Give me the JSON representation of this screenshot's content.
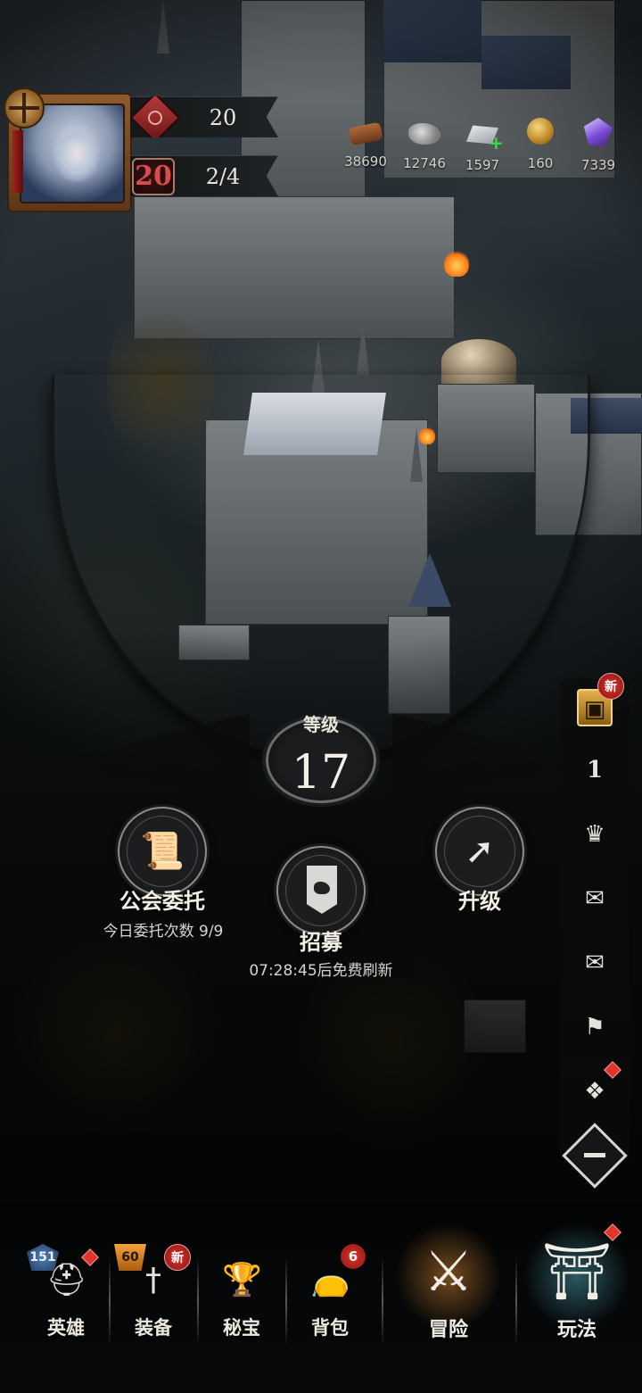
{
  "hud": {
    "player": {
      "portrait_icon": "hero-portrait-icon",
      "power_value": "20",
      "level_badge": "20",
      "slots_progress": "2/4"
    },
    "resources": [
      {
        "name": "wood",
        "icon": "wood-log-icon",
        "value": "38690"
      },
      {
        "name": "stone",
        "icon": "stone-icon",
        "value": "12746"
      },
      {
        "name": "iron",
        "icon": "iron-ingot-icon",
        "value": "1597",
        "has_plus": true
      },
      {
        "name": "gold",
        "icon": "gold-coin-icon",
        "value": "160"
      },
      {
        "name": "crystal",
        "icon": "purple-crystal-icon",
        "value": "7339"
      }
    ],
    "plus_mark": "+"
  },
  "level": {
    "label": "等级",
    "value": "17"
  },
  "actions": {
    "guild": {
      "title": "公会委托",
      "subtitle": "今日委托次数 9/9",
      "icon": "scroll-icon"
    },
    "recruit": {
      "title": "招募",
      "subtitle": "07:28:45后免费刷新",
      "icon": "banner-icon"
    },
    "upgrade": {
      "title": "升级",
      "icon": "arrow-up-icon"
    }
  },
  "sidebar": {
    "items": [
      {
        "icon": "event-tower-icon",
        "badge": "新"
      },
      {
        "icon": "trophy-rank-icon",
        "text": "1"
      },
      {
        "icon": "crown-ribbon-icon"
      },
      {
        "icon": "scroll-quest-icon"
      },
      {
        "icon": "mail-icon"
      },
      {
        "icon": "banner-guild-icon"
      },
      {
        "icon": "spellbook-icon",
        "dot": true
      }
    ],
    "collapse_symbol": "−"
  },
  "bottom_nav": [
    {
      "label": "英雄",
      "icon": "knight-helmet-icon",
      "chip": "151",
      "dot": true
    },
    {
      "label": "装备",
      "icon": "sword-icon",
      "chip": "60",
      "badge": "新"
    },
    {
      "label": "秘宝",
      "icon": "chalice-icon"
    },
    {
      "label": "背包",
      "icon": "bag-icon",
      "count": "6"
    },
    {
      "label": "冒险",
      "icon": "crossed-swords-icon"
    },
    {
      "label": "玩法",
      "icon": "gothic-arch-icon",
      "dot": true
    }
  ],
  "colors": {
    "accent_red": "#d8332b",
    "text_light": "#ece8df",
    "plus_green": "#39d94a"
  }
}
